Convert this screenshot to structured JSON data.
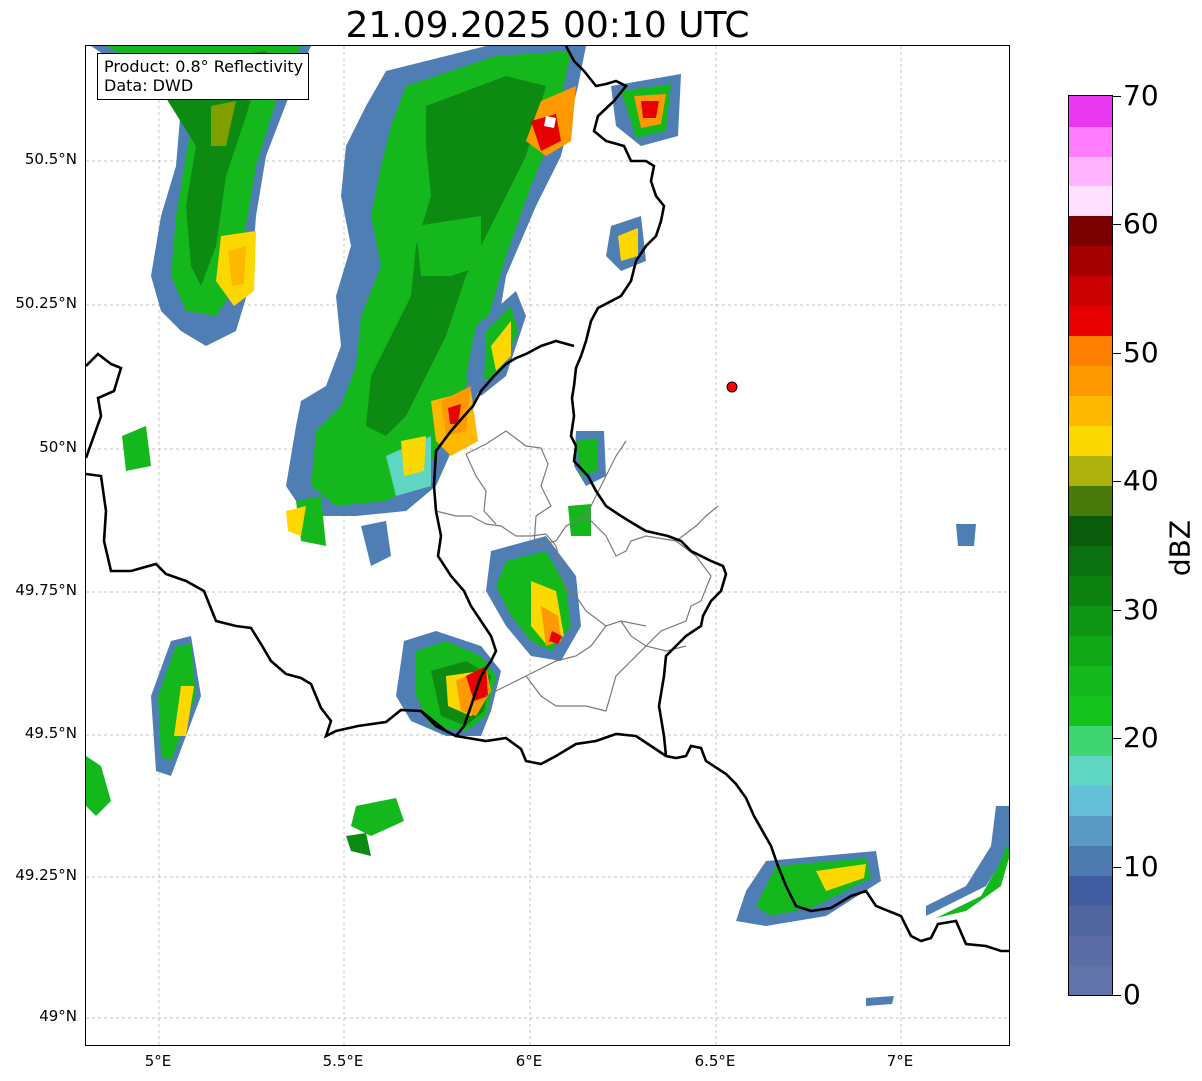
{
  "title": "21.09.2025 00:10 UTC",
  "info": {
    "product": "Product: 0.8° Reflectivity",
    "data": "Data: DWD"
  },
  "axes": {
    "lat_ticks": [
      "50.5°N",
      "50.25°N",
      "50°N",
      "49.75°N",
      "49.5°N",
      "49.25°N",
      "49°N"
    ],
    "lon_ticks": [
      "5°E",
      "5.5°E",
      "6°E",
      "6.5°E",
      "7°E"
    ]
  },
  "colorbar": {
    "unit": "dBZ",
    "ticks": [
      "0",
      "10",
      "20",
      "30",
      "40",
      "50",
      "60",
      "70"
    ],
    "colors": [
      "#6173a8",
      "#5b6da4",
      "#4f669f",
      "#425ca1",
      "#4d7bb0",
      "#5a9ac4",
      "#63c0d8",
      "#5fd6c2",
      "#3fd570",
      "#14c41c",
      "#13b81c",
      "#11a818",
      "#0f9614",
      "#0d8211",
      "#0b700f",
      "#0a5c0c",
      "#477a0a",
      "#adb20d",
      "#fdd700",
      "#feb800",
      "#fe9a00",
      "#fe7f00",
      "#e60000",
      "#c80000",
      "#a50000",
      "#7d0000",
      "#ffe0ff",
      "#ffb3ff",
      "#ff7cff",
      "#e838ef"
    ]
  },
  "radar_marker": {
    "color": "#ff0000"
  }
}
